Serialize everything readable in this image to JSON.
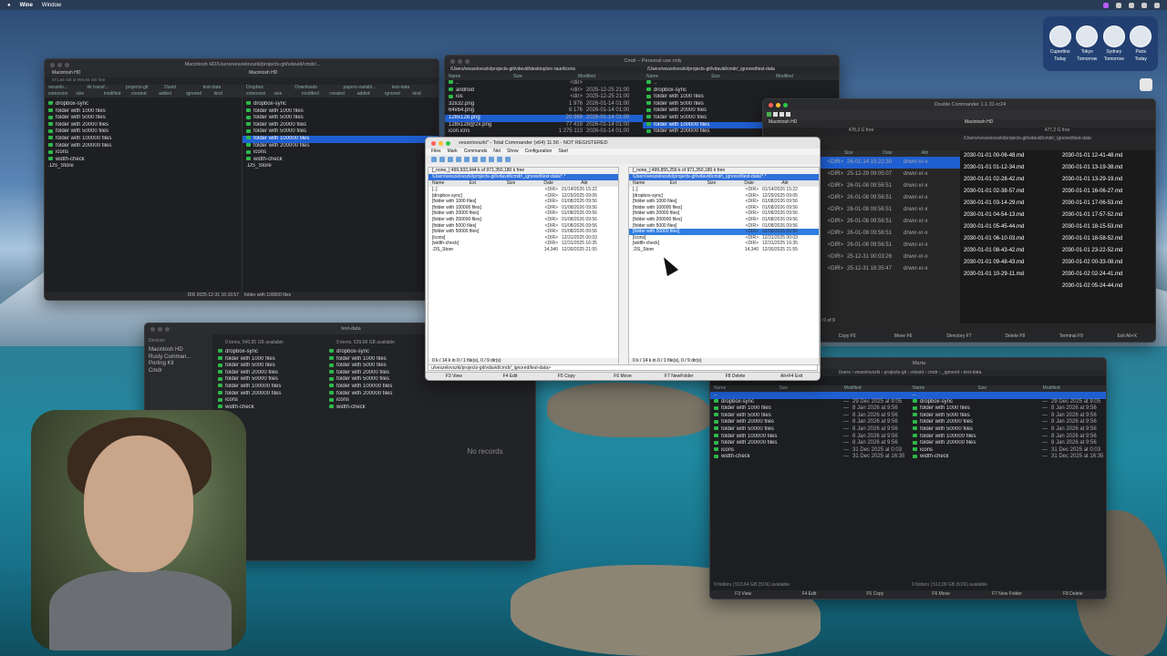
{
  "menubar": {
    "app": "Wine",
    "menu": "Window"
  },
  "clock_widget": [
    {
      "city": "Cupertino",
      "day": "Today"
    },
    {
      "city": "Tokyo",
      "day": "Tomorrow"
    },
    {
      "city": "Sydney",
      "day": "Tomorrow"
    },
    {
      "city": "Paris",
      "day": "Today"
    }
  ],
  "win_tl": {
    "title": "Macintosh HD/Users/veszelovszki/projects-git/vdavid/cmdr/...",
    "left_tab": "Macintosh HD",
    "right_tab": "Macintosh HD",
    "free_left": "571,64 GB of 994,66 GB free",
    "right_tabs": [
      "Dropbox",
      "Downloads",
      "papers-variabl...",
      "test-data"
    ],
    "left_tabs": [
      "veszelo...",
      "tkt transf...",
      "projects-git",
      "David",
      "test-data"
    ],
    "cols": [
      "extension",
      "size",
      "modified",
      "created",
      "added",
      "ignored",
      "kind"
    ],
    "items": [
      "dropbox-sync",
      "folder with 1000 files",
      "folder with 5000 files",
      "folder with 20000 files",
      "folder with 50000 files",
      "folder with 100000 files",
      "folder with 200000 files",
      "icons",
      "width-check",
      ".DS_Store"
    ],
    "footer_left": "DIR  2025-12-31 16:16:57",
    "footer_right": "folder with 100000 files"
  },
  "win_tm": {
    "title": "Cmdr – Personal use only",
    "left_path": "/Users/veszelovszki/projects-git/vdavid/desktop/src-tauri/icons",
    "right_path": "/Users/veszelovszki/projects-git/vdavid/cmdr/_ignored/test-data",
    "left_items": [
      {
        "n": "..",
        "s": "<dir>",
        "d": ""
      },
      {
        "n": "android",
        "s": "<dir>",
        "d": "2025-12-25 21:00"
      },
      {
        "n": "ios",
        "s": "<dir>",
        "d": "2025-12-25 21:00"
      },
      {
        "n": "32x32.png",
        "s": "1 976",
        "d": "2026-01-14 01:00"
      },
      {
        "n": "64x64.png",
        "s": "6 176",
        "d": "2026-01-14 01:00"
      },
      {
        "n": "128x128.png",
        "s": "20 969",
        "d": "2026-01-14 01:00"
      },
      {
        "n": "128x128@2x.png",
        "s": "77 419",
        "d": "2026-01-14 01:00"
      },
      {
        "n": "icon.icns",
        "s": "1 275 113",
        "d": "2026-01-14 01:00"
      }
    ],
    "right_items": [
      "..",
      "dropbox-sync",
      "folder with 1000 files",
      "folder with 5000 files",
      "folder with 20000 files",
      "folder with 50000 files",
      "folder with 100000 files",
      "folder with 200000 files"
    ]
  },
  "win_dc": {
    "title": "Double Commander 1.1.31-rc24",
    "drive_left": "Macintosh HD",
    "drive_right": "Macintosh HD",
    "free_left": "478,3 G free",
    "free_right": "477,2 G free",
    "path_right": "/Users/veszelovszki/projects-git/vdavid/cmdr/_ignored/test-data",
    "cols": [
      "Name",
      "Ext",
      "Size",
      "Date",
      "Attr"
    ],
    "rows": [
      {
        "n": "[..]",
        "s": "<DIR>",
        "d": "26-01-14 15:22:30",
        "a": "drwxr-xr-x"
      },
      {
        "n": "",
        "s": "<DIR>",
        "d": "25-12-29 09:05:07",
        "a": "drwxr-xr-x"
      },
      {
        "n": "",
        "s": "<DIR>",
        "d": "26-01-08 09:56:51",
        "a": "drwxr-xr-x"
      },
      {
        "n": "",
        "s": "<DIR>",
        "d": "26-01-08 09:56:51",
        "a": "drwxr-xr-x"
      },
      {
        "n": "",
        "s": "<DIR>",
        "d": "26-01-08 09:56:51",
        "a": "drwxr-xr-x"
      },
      {
        "n": "",
        "s": "<DIR>",
        "d": "26-01-08 09:56:51",
        "a": "drwxr-xr-x"
      },
      {
        "n": "",
        "s": "<DIR>",
        "d": "26-01-08 09:56:51",
        "a": "drwxr-xr-x"
      },
      {
        "n": "",
        "s": "<DIR>",
        "d": "26-01-08 09:56:51",
        "a": "drwxr-xr-x"
      },
      {
        "n": "",
        "s": "<DIR>",
        "d": "25-12-31 00:03:26",
        "a": "drwxr-xr-x"
      },
      {
        "n": "",
        "s": "<DIR>",
        "d": "25-12-31 16:35:47",
        "a": "drwxr-xr-x"
      }
    ],
    "thumbs": [
      "2030-01-01 00-06-48.md",
      "2030-01-01 01-12-34.md",
      "2030-01-01 02-28-42.md",
      "2030-01-01 02-38-57.md",
      "2030-01-01 03-14-29.md",
      "2030-01-01 04-54-13.md",
      "2030-01-01 05-45-44.md",
      "2030-01-01 06-10-03.md",
      "2030-01-01 08-43-42.md",
      "2030-01-01 09-48-43.md",
      "2030-01-01 10-29-11.md"
    ],
    "thumbs2": [
      "2030-01-01 12-41-48.md",
      "2030-01-01 13-19-38.md",
      "2030-01-01 13-29-19.md",
      "2030-01-01 16-06-27.md",
      "2030-01-01 17-06-53.md",
      "2030-01-01 17-57-52.md",
      "2030-01-01 18-15-53.md",
      "2030-01-01 18-58-52.md",
      "2030-01-01 23-22-52.md",
      "2030-01-02 00-33-08.md",
      "2030-01-02 02-24-41.md",
      "2030-01-02 05-24-44.md"
    ],
    "status": "0 / 0 in 0 / 0 file(s), folders: 0 of 9",
    "fkeys": [
      "Edit F4",
      "Copy F5",
      "Move F6",
      "Directory F7",
      "Delete F8",
      "Terminal F9",
      "Exit Alt+X"
    ]
  },
  "win_tc": {
    "title": "veszelovszki\" - Total Commander (x64) 11.56 - NOT REGISTERED",
    "menu": [
      "Files",
      "Mark",
      "Commands",
      "Net",
      "Show",
      "Configuration",
      "Start"
    ],
    "drive_left": "[_none_]  499,933,944 k of 971,350,180 k free",
    "drive_right": "[_none_]  499,855,256 k of 971,350,180 k free",
    "cols": [
      "Name",
      "Ext",
      "Size",
      "Date",
      "Attr"
    ],
    "left_rows": [
      {
        "n": "[..]",
        "s": "<DIR>",
        "d": "01/14/2026 15:22"
      },
      {
        "n": "[dropbox-sync]",
        "s": "<DIR>",
        "d": "12/29/2025 09:05"
      },
      {
        "n": "[folder with 1000 files]",
        "s": "<DIR>",
        "d": "01/08/2026 09:56"
      },
      {
        "n": "[folder with 100000 files]",
        "s": "<DIR>",
        "d": "01/08/2026 09:56"
      },
      {
        "n": "[folder with 20000 files]",
        "s": "<DIR>",
        "d": "01/08/2026 09:56"
      },
      {
        "n": "[folder with 200000 files]",
        "s": "<DIR>",
        "d": "01/08/2026 09:56"
      },
      {
        "n": "[folder with 5000 files]",
        "s": "<DIR>",
        "d": "01/08/2026 09:56"
      },
      {
        "n": "[folder with 50000 files]",
        "s": "<DIR>",
        "d": "01/08/2026 09:56"
      },
      {
        "n": "[icons]",
        "s": "<DIR>",
        "d": "12/31/2025 00:03"
      },
      {
        "n": "[width-check]",
        "s": "<DIR>",
        "d": "12/31/2025 16:35"
      },
      {
        "n": ".DS_Store",
        "s": "14,340",
        "d": "12/30/2025 21:55"
      }
    ],
    "right_rows": [
      {
        "n": "[..]",
        "s": "<DIR>",
        "d": "01/14/2026 15:22"
      },
      {
        "n": "[dropbox-sync]",
        "s": "<DIR>",
        "d": "12/29/2025 09:05"
      },
      {
        "n": "[folder with 1000 files]",
        "s": "<DIR>",
        "d": "01/08/2026 09:56"
      },
      {
        "n": "[folder with 100000 files]",
        "s": "<DIR>",
        "d": "01/08/2026 09:56"
      },
      {
        "n": "[folder with 20000 files]",
        "s": "<DIR>",
        "d": "01/08/2026 09:56"
      },
      {
        "n": "[folder with 200000 files]",
        "s": "<DIR>",
        "d": "01/08/2026 09:56"
      },
      {
        "n": "[folder with 5000 files]",
        "s": "<DIR>",
        "d": "01/08/2026 09:56"
      },
      {
        "n": "[folder with 50000 files]",
        "s": "<DIR>",
        "d": "01/08/2026 09:56"
      },
      {
        "n": "[icons]",
        "s": "<DIR>",
        "d": "12/31/2025 00:03"
      },
      {
        "n": "[width-check]",
        "s": "<DIR>",
        "d": "12/31/2025 16:35"
      },
      {
        "n": ".DS_Store",
        "s": "14,340",
        "d": "12/30/2025 21:55"
      }
    ],
    "status_left": "0 k / 14 k in 0 / 1 file(s), 0 / 9 dir(s)",
    "status_right": "0 k / 14 k in 0 / 1 file(s), 0 / 9 dir(s)",
    "cmdline": "u/veszelovszki/projects-git/vdavid/cmdr/_ignored/test-data>",
    "fkeys": [
      "F3 View",
      "F4 Edit",
      "F5 Copy",
      "F6 Move",
      "F7 NewFolder",
      "F8 Delete",
      "Alt+F4 Exit"
    ]
  },
  "win_finder": {
    "title": "test-data",
    "sidebar_head": "Devices",
    "sidebar": [
      "Macintosh HD",
      "Rusty Comman...",
      "Porting Kit",
      "Cmdr"
    ],
    "left_info": "9 items, 540,85 GB available",
    "right_info": "9 items, 539,68 GB available",
    "items": [
      "dropbox-sync",
      "folder with 1000 files",
      "folder with 5000 files",
      "folder with 20000 files",
      "folder with 50000 files",
      "folder with 100000 files",
      "folder with 200000 files",
      "icons",
      "width-check"
    ],
    "no_records": "No records"
  },
  "win_marta": {
    "title": "Marta",
    "breadcrumb": "Users › veszelovszki › projects-git › vdavid › cmdr › _ignored › test-data",
    "items": [
      {
        "n": "dropbox-sync",
        "d": "29 Dec 2025 at 9:05"
      },
      {
        "n": "folder with 1000 files",
        "d": "8 Jan 2026 at 9:56"
      },
      {
        "n": "folder with 5000 files",
        "d": "8 Jan 2026 at 9:56"
      },
      {
        "n": "folder with 20000 files",
        "d": "8 Jan 2026 at 9:56"
      },
      {
        "n": "folder with 50000 files",
        "d": "8 Jan 2026 at 9:56"
      },
      {
        "n": "folder with 100000 files",
        "d": "8 Jan 2026 at 9:56"
      },
      {
        "n": "folder with 200000 files",
        "d": "8 Jan 2026 at 9:56"
      },
      {
        "n": "icons",
        "d": "31 Dec 2025 at 0:03"
      },
      {
        "n": "width-check",
        "d": "31 Dec 2025 at 16:35"
      }
    ],
    "status_left": "9 folders | 513,64 GB (51%) available",
    "status_right": "9 folders | 512,09 GB (51%) available",
    "fkeys": [
      "F3 View",
      "F4 Edit",
      "F5 Copy",
      "F6 Move",
      "F7 New Folder",
      "F8 Delete"
    ]
  }
}
